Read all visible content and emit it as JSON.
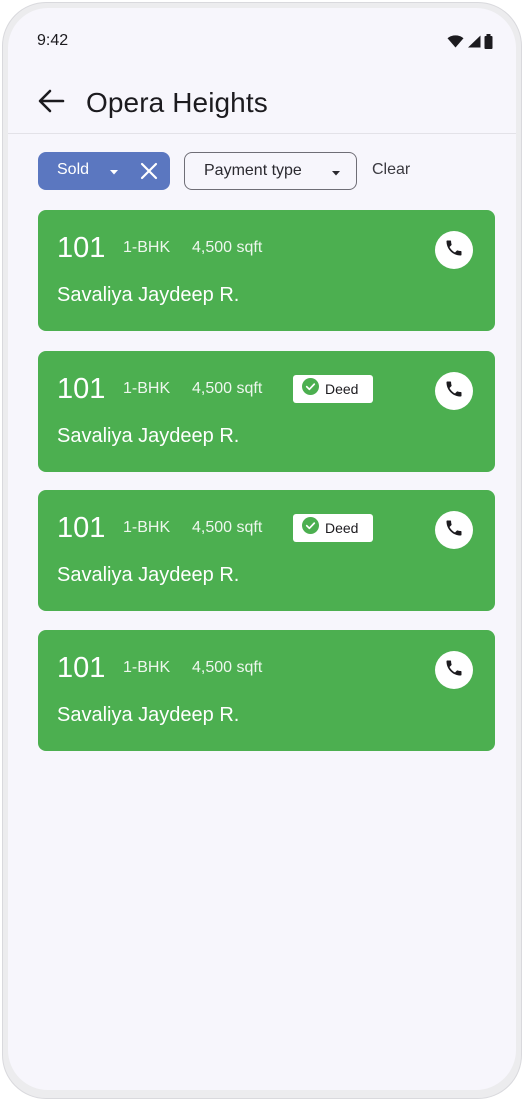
{
  "status_bar": {
    "time": "9:42"
  },
  "header": {
    "title": "Opera Heights"
  },
  "filters": {
    "sold_label": "Sold",
    "payment_label": "Payment type",
    "clear_label": "Clear"
  },
  "units": [
    {
      "unit": "101",
      "type": "1-BHK",
      "area": "4,500 sqft",
      "badge": "",
      "owner": "Savaliya Jaydeep R."
    },
    {
      "unit": "101",
      "type": "1-BHK",
      "area": "4,500 sqft",
      "badge": "Deed",
      "owner": "Savaliya Jaydeep R."
    },
    {
      "unit": "101",
      "type": "1-BHK",
      "area": "4,500 sqft",
      "badge": "Deed",
      "owner": "Savaliya Jaydeep R."
    },
    {
      "unit": "101",
      "type": "1-BHK",
      "area": "4,500 sqft",
      "badge": "",
      "owner": "Savaliya Jaydeep R."
    }
  ],
  "colors": {
    "card_green": "#4caf50",
    "chip_blue": "#5b77c0",
    "badge_check_green": "#4caf50"
  },
  "icons": [
    "wifi-icon",
    "signal-icon",
    "battery-icon",
    "back-arrow-icon",
    "caret-down-icon",
    "close-icon",
    "check-circle-icon",
    "phone-icon"
  ]
}
